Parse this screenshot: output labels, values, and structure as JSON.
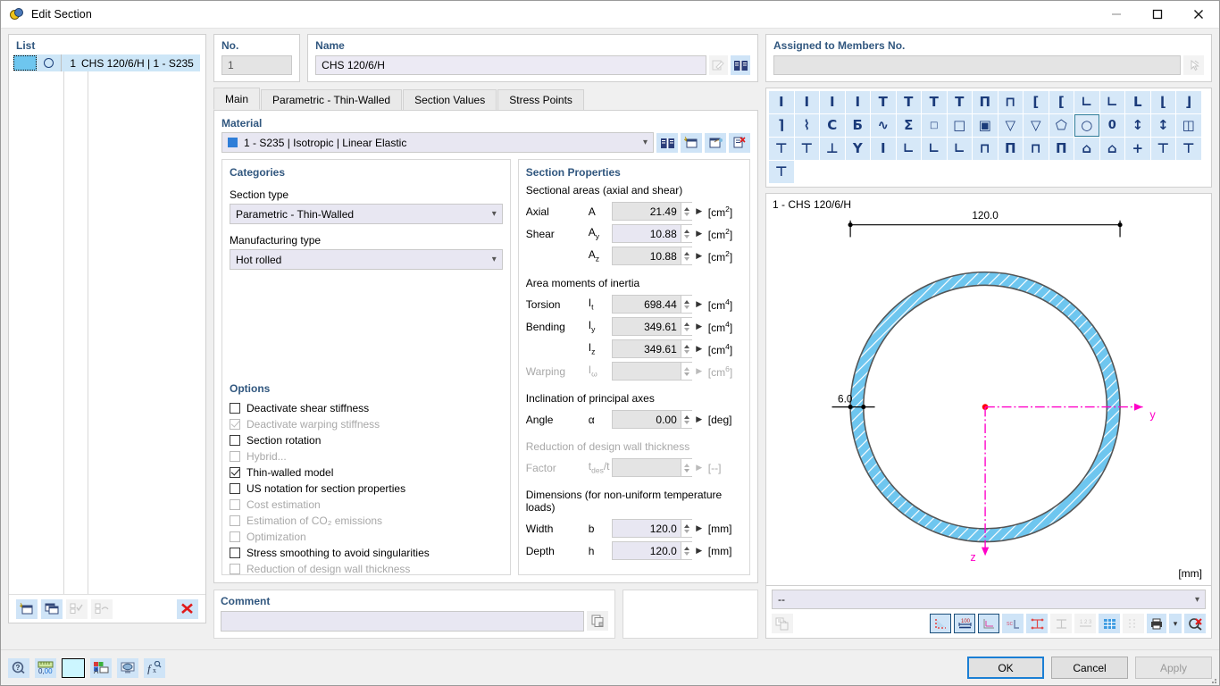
{
  "window": {
    "title": "Edit Section",
    "icon": "section-icon",
    "minimize": "minimize-icon",
    "maximize": "maximize-icon",
    "close": "close-icon"
  },
  "list": {
    "header": "List",
    "rows": [
      {
        "number": "1",
        "label": "CHS 120/6/H | 1 - S235",
        "color": "#6ec6ef"
      }
    ],
    "toolbar": [
      {
        "name": "new-section-button",
        "enabled": true
      },
      {
        "name": "copy-section-button",
        "enabled": true
      },
      {
        "name": "select-all-button",
        "enabled": false
      },
      {
        "name": "invert-selection-button",
        "enabled": false
      },
      {
        "name": "delete-section-button",
        "enabled": true
      }
    ]
  },
  "number_field": {
    "label": "No.",
    "value": "1"
  },
  "name_field": {
    "label": "Name",
    "value": "CHS 120/6/H",
    "buttons": [
      {
        "name": "edit-name-button",
        "enabled": false
      },
      {
        "name": "section-library-button",
        "enabled": true
      }
    ]
  },
  "assigned": {
    "label": "Assigned to Members No.",
    "value": "",
    "pick_button": "pick-members-button"
  },
  "tabs": [
    {
      "label": "Main",
      "active": true
    },
    {
      "label": "Parametric - Thin-Walled",
      "active": false
    },
    {
      "label": "Section Values",
      "active": false
    },
    {
      "label": "Stress Points",
      "active": false
    }
  ],
  "material": {
    "label": "Material",
    "value": "1 - S235 | Isotropic | Linear Elastic",
    "swatch_color": "#2f7ed8",
    "buttons": [
      {
        "name": "material-library-button"
      },
      {
        "name": "new-material-button"
      },
      {
        "name": "edit-material-button"
      },
      {
        "name": "delete-material-button"
      }
    ]
  },
  "categories": {
    "title": "Categories",
    "section_type": {
      "label": "Section type",
      "value": "Parametric - Thin-Walled"
    },
    "manufacturing_type": {
      "label": "Manufacturing type",
      "value": "Hot rolled"
    },
    "options_title": "Options",
    "options": [
      {
        "label": "Deactivate shear stiffness",
        "checked": false,
        "enabled": true
      },
      {
        "label": "Deactivate warping stiffness",
        "checked": true,
        "enabled": false
      },
      {
        "label": "Section rotation",
        "checked": false,
        "enabled": true
      },
      {
        "label": "Hybrid...",
        "checked": false,
        "enabled": false
      },
      {
        "label": "Thin-walled model",
        "checked": true,
        "enabled": true
      },
      {
        "label": "US notation for section properties",
        "checked": false,
        "enabled": true
      },
      {
        "label": "Cost estimation",
        "checked": false,
        "enabled": false
      },
      {
        "label": "Estimation of CO₂ emissions",
        "checked": false,
        "enabled": false
      },
      {
        "label": "Optimization",
        "checked": false,
        "enabled": false
      },
      {
        "label": "Stress smoothing to avoid singularities",
        "checked": false,
        "enabled": true
      },
      {
        "label": "Reduction of design wall thickness",
        "checked": false,
        "enabled": false
      }
    ]
  },
  "section_properties": {
    "title": "Section Properties",
    "groups": [
      {
        "heading": "Sectional areas (axial and shear)",
        "enabled": true,
        "rows": [
          {
            "name": "Axial",
            "symbol": "A",
            "sub": "",
            "value": "21.49",
            "unit": "cm",
            "exp": "2",
            "highlight": false,
            "enabled": true
          },
          {
            "name": "Shear",
            "symbol": "A",
            "sub": "y",
            "value": "10.88",
            "unit": "cm",
            "exp": "2",
            "highlight": true,
            "enabled": true
          },
          {
            "name": "",
            "symbol": "A",
            "sub": "z",
            "value": "10.88",
            "unit": "cm",
            "exp": "2",
            "highlight": false,
            "enabled": true
          }
        ]
      },
      {
        "heading": "Area moments of inertia",
        "enabled": true,
        "rows": [
          {
            "name": "Torsion",
            "symbol": "I",
            "sub": "t",
            "value": "698.44",
            "unit": "cm",
            "exp": "4",
            "highlight": false,
            "enabled": true
          },
          {
            "name": "Bending",
            "symbol": "I",
            "sub": "y",
            "value": "349.61",
            "unit": "cm",
            "exp": "4",
            "highlight": false,
            "enabled": true
          },
          {
            "name": "",
            "symbol": "I",
            "sub": "z",
            "value": "349.61",
            "unit": "cm",
            "exp": "4",
            "highlight": false,
            "enabled": true
          },
          {
            "name": "Warping",
            "symbol": "I",
            "sub": "ω",
            "value": "",
            "unit": "cm",
            "exp": "6",
            "highlight": false,
            "enabled": false
          }
        ]
      },
      {
        "heading": "Inclination of principal axes",
        "enabled": true,
        "rows": [
          {
            "name": "Angle",
            "symbol": "α",
            "sub": "",
            "value": "0.00",
            "unit": "deg",
            "exp": "",
            "highlight": false,
            "enabled": true
          }
        ]
      },
      {
        "heading": "Reduction of design wall thickness",
        "enabled": false,
        "rows": [
          {
            "name": "Factor",
            "symbol": "t",
            "sub": "des",
            "symbol_suffix": "/t",
            "value": "",
            "unit": "--",
            "exp": "",
            "highlight": false,
            "enabled": false
          }
        ]
      },
      {
        "heading": "Dimensions (for non-uniform temperature loads)",
        "enabled": true,
        "rows": [
          {
            "name": "Width",
            "symbol": "b",
            "sub": "",
            "value": "120.0",
            "unit": "mm",
            "exp": "",
            "highlight": true,
            "enabled": true
          },
          {
            "name": "Depth",
            "symbol": "h",
            "sub": "",
            "value": "120.0",
            "unit": "mm",
            "exp": "",
            "highlight": true,
            "enabled": true
          }
        ]
      }
    ]
  },
  "comment": {
    "label": "Comment",
    "value": "",
    "copy_button": "copy-comment-button"
  },
  "shape_grid": {
    "rows": [
      [
        "I-beam-1",
        "I-beam-2",
        "I-beam-3",
        "I-beam-4",
        "T-section-1",
        "T-section-2",
        "T-section-3",
        "T-section-4",
        "double-T-1",
        "double-I-1",
        "channel-1",
        "channel-2",
        "channel-3",
        "angle-1",
        "angle-2",
        "angle-3",
        "angle-4",
        "angle-5"
      ],
      [
        "z-section-1",
        "C-section-1",
        "C-section-bent",
        "hat-section",
        "sigma-section",
        "square-hollow-small",
        "rect-hollow-1",
        "rect-hollow-filled",
        "trapezoid-1",
        "trapezoid-2",
        "circle-hollow-thick",
        "circular-hollow-section",
        "round-bar",
        "I-var-1",
        "I-var-2",
        "double-chamber",
        "I-cut-1",
        "I-cut-2"
      ],
      [
        "I-flanged-1",
        "Y-section",
        "I-stiffened",
        "C-bent-1",
        "Z-bent-1",
        "Z-bent-2",
        "double-web-1",
        "double-web-2",
        "double-web-3",
        "double-web-4",
        "bullet-section",
        "arrow-section",
        "cross-section",
        "T-inverted-1",
        "T-inverted-2",
        "T-inverted-3"
      ]
    ],
    "selected": {
      "row": 1,
      "col": 11
    }
  },
  "drawing": {
    "title": "1 - CHS 120/6/H",
    "unit_label": "[mm]",
    "outer_diameter": "120.0",
    "wall_thickness": "6.0",
    "axis_y": "y",
    "axis_z": "z",
    "fill_color": "#6ec6ef",
    "axis_color": "#ff00c8"
  },
  "draw_bottom": {
    "selector_value": "--",
    "left_button": "export-view-button",
    "buttons": [
      {
        "name": "show-section-outline-button",
        "active": true,
        "enabled": true
      },
      {
        "name": "show-dimensions-button",
        "active": true,
        "enabled": true
      },
      {
        "name": "show-axes-button",
        "active": true,
        "enabled": true
      },
      {
        "name": "show-shear-center-button",
        "active": false,
        "enabled": true
      },
      {
        "name": "show-stress-points-button",
        "active": false,
        "enabled": true
      },
      {
        "name": "show-parts-button",
        "active": false,
        "enabled": false
      },
      {
        "name": "show-numbering-button",
        "active": false,
        "enabled": false
      },
      {
        "name": "show-grid-button",
        "active": false,
        "enabled": true
      },
      {
        "name": "show-snap-button",
        "active": false,
        "enabled": false
      },
      {
        "name": "print-button",
        "active": false,
        "enabled": true
      },
      {
        "name": "print-dropdown-button",
        "active": false,
        "enabled": true
      },
      {
        "name": "reset-zoom-button",
        "active": false,
        "enabled": true
      }
    ]
  },
  "footer": {
    "tools": [
      {
        "name": "help-button"
      },
      {
        "name": "units-button"
      },
      {
        "name": "color-swatch-button",
        "color": "#ccf6ff"
      },
      {
        "name": "display-properties-button"
      },
      {
        "name": "visibility-button"
      },
      {
        "name": "formula-button"
      }
    ],
    "ok": "OK",
    "cancel": "Cancel",
    "apply": "Apply"
  }
}
